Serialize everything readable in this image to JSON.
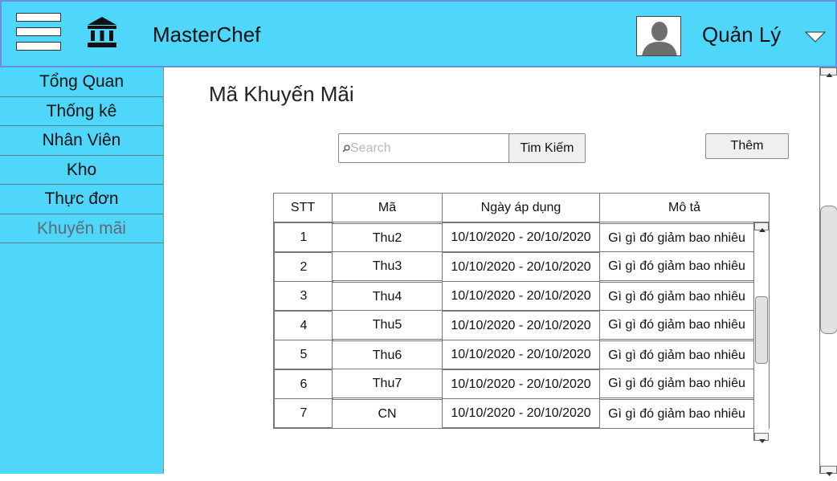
{
  "header": {
    "app_title": "MasterChef",
    "user_name": "Quản Lý",
    "icons": {
      "menu": "hamburger-menu-icon",
      "logo": "bank-icon",
      "avatar": "user-avatar",
      "dropdown": "chevron-down-icon"
    },
    "colors": {
      "header_bg": "#4fd6fb",
      "header_border": "#6b8fe0"
    }
  },
  "sidebar": {
    "items": [
      {
        "label": "Tổng Quan"
      },
      {
        "label": "Thống kê"
      },
      {
        "label": "Nhân Viên"
      },
      {
        "label": "Kho"
      },
      {
        "label": "Thực đơn"
      },
      {
        "label": "Khuyến mãi",
        "active": true
      }
    ],
    "colors": {
      "bg": "#4fd6fb",
      "active_text": "#5e6c72"
    }
  },
  "main": {
    "page_title": "Mã Khuyến Mãi",
    "search": {
      "placeholder": "Search",
      "value": "",
      "button_label": "Tim Kiếm"
    },
    "add_button_label": "Thêm",
    "table": {
      "columns": [
        "STT",
        "Mã",
        "Ngày áp dụng",
        "Mô tả"
      ],
      "rows": [
        [
          "1",
          "Thu2",
          "10/10/2020 - 20/10/2020",
          "Gì gì đó giảm bao nhiêu"
        ],
        [
          "2",
          "Thu3",
          "10/10/2020 - 20/10/2020",
          "Gì gì đó giảm bao nhiêu"
        ],
        [
          "3",
          "Thu4",
          "10/10/2020 - 20/10/2020",
          "Gì gì đó giảm bao nhiêu"
        ],
        [
          "4",
          "Thu5",
          "10/10/2020 - 20/10/2020",
          "Gì gì đó giảm bao nhiêu"
        ],
        [
          "5",
          "Thu6",
          "10/10/2020 - 20/10/2020",
          "Gì gì đó giảm bao nhiêu"
        ],
        [
          "6",
          "Thu7",
          "10/10/2020 - 20/10/2020",
          "Gì gì đó giảm bao nhiêu"
        ],
        [
          "7",
          "CN",
          "10/10/2020 - 20/10/2020",
          "Gì gì đó giảm bao nhiêu"
        ]
      ]
    }
  }
}
